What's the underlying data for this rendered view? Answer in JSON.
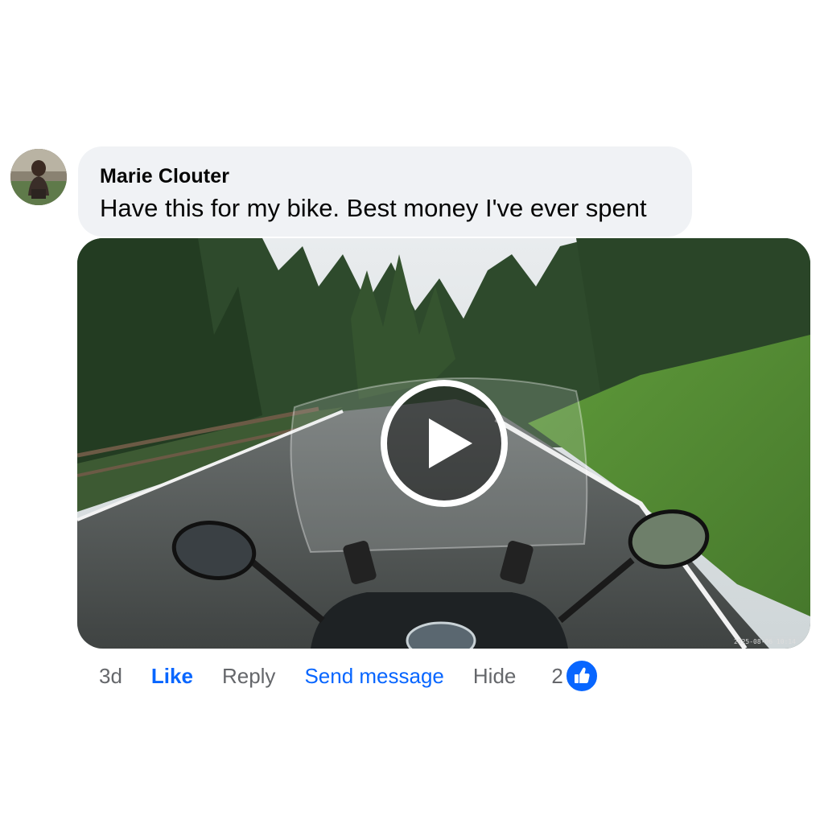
{
  "comment": {
    "author": "Marie Clouter",
    "text": "Have this for my bike. Best money I've ever spent",
    "avatar_icon": "user-avatar-photo"
  },
  "video": {
    "play_icon": "play-icon",
    "timestamp": "2025-08-06 10:14"
  },
  "actions": {
    "time": "3d",
    "like": "Like",
    "reply": "Reply",
    "send_message": "Send message",
    "hide": "Hide",
    "reaction_count": "2",
    "reaction_icon": "thumbs-up-icon"
  },
  "colors": {
    "accent": "#0866ff",
    "bubble": "#f0f2f5",
    "secondary_text": "#65676b"
  }
}
